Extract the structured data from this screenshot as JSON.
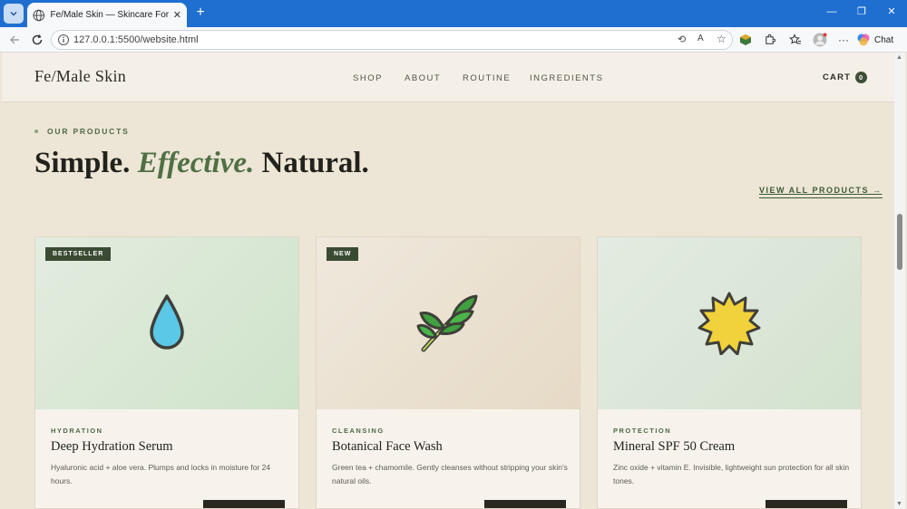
{
  "browser": {
    "tab_title": "Fe/Male Skin — Skincare For Everyone",
    "url": "127.0.0.1:5500/website.html",
    "chat_label": "Chat"
  },
  "site": {
    "logo": "Fe/Male Skin",
    "nav": [
      "SHOP",
      "ABOUT",
      "ROUTINE",
      "INGREDIENTS"
    ],
    "cart_label": "CART",
    "cart_count": "0"
  },
  "section": {
    "eyebrow": "OUR PRODUCTS",
    "headline_part1": "Simple.",
    "headline_italic": "Effective.",
    "headline_part2": "Natural.",
    "view_all": "VIEW ALL PRODUCTS →"
  },
  "products": [
    {
      "badge": "BESTSELLER",
      "category": "HYDRATION",
      "name": "Deep Hydration Serum",
      "description": "Hyaluronic acid + aloe vera. Plumps and locks in moisture for 24 hours.",
      "icon": "droplet-icon"
    },
    {
      "badge": "NEW",
      "category": "CLEANSING",
      "name": "Botanical Face Wash",
      "description": "Green tea + chamomile. Gently cleanses without stripping your skin's natural oils.",
      "icon": "leaf-icon"
    },
    {
      "badge": "",
      "category": "PROTECTION",
      "name": "Mineral SPF 50 Cream",
      "description": "Zinc oxide + vitamin E. Invisible, lightweight sun protection for all skin tones.",
      "icon": "sun-icon"
    }
  ],
  "colors": {
    "accent_green": "#3f4e37",
    "page_bg": "#ede5d6",
    "headline_italic": "#4f7044"
  }
}
